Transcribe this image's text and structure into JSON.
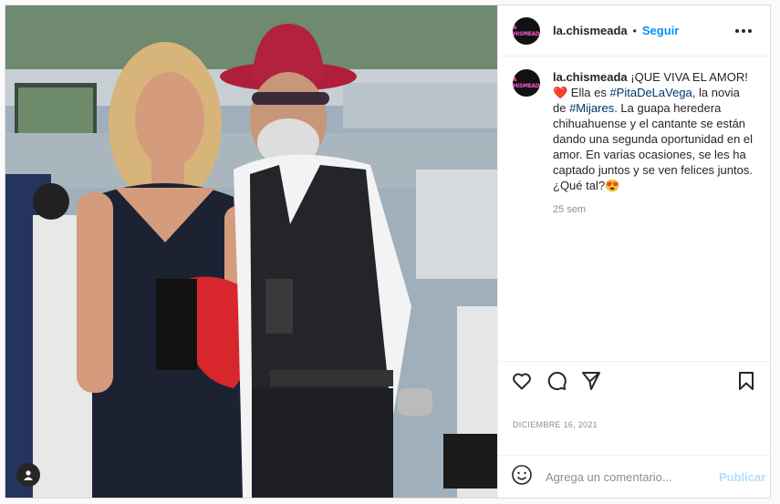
{
  "post": {
    "username": "la.chismeada",
    "avatar_text": "LA CHISMEADA",
    "follow_label": "Seguir",
    "caption": {
      "username": "la.chismeada",
      "part1": " ¡QUE VIVA EL AMOR!",
      "emoji1": "❤️",
      "part2": " Ella es ",
      "tag1": "#PitaDeLaVega",
      "part3": ", la novia de ",
      "tag2": "#Mijares",
      "part4": ". La guapa heredera chihuahuense y el cantante se están dando una segunda oportunidad en el amor. En varias ocasiones, se les ha captado juntos y se ven felices juntos. ¿Qué tal?",
      "emoji2": "😍"
    },
    "time_ago": "25 sem",
    "date": "DICIEMBRE 16, 2021",
    "comment_placeholder": "Agrega un comentario...",
    "publish_label": "Publicar"
  },
  "icons": {
    "like": "heart-icon",
    "comment": "comment-icon",
    "share": "send-icon",
    "save": "bookmark-icon",
    "emoji": "emoji-icon",
    "more": "more-icon",
    "user_tag": "user-tag-icon"
  },
  "colors": {
    "accent": "#0095f6",
    "publish_disabled": "#b2dffc",
    "text": "#262626",
    "muted": "#8e8e8e",
    "hashtag": "#00376b"
  }
}
